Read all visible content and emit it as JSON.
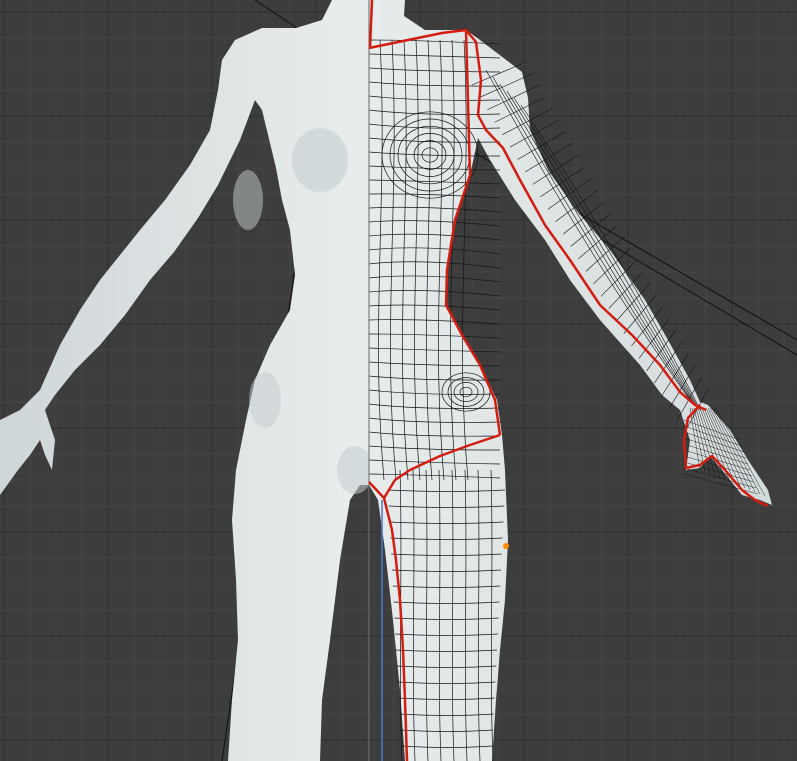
{
  "viewport": {
    "mode": "edit",
    "view": "front-ortho",
    "shading_left": "solid",
    "overlay_right": "wireframe",
    "symmetry": "mirror-x"
  },
  "colors": {
    "background": "#3d3d3d",
    "grid_minor": "#444444",
    "grid_major": "#2e2e2e",
    "mesh_fill": "#dfe4e5",
    "mesh_shadow": "#b9c1c3",
    "wire": "#111111",
    "seam": "#d31d10",
    "axis_z": "#4a7bd1",
    "selected_vertex": "#ff8c00"
  },
  "icons": [
    "mesh-body-icon",
    "seam-icon",
    "selected-vertex-icon"
  ]
}
